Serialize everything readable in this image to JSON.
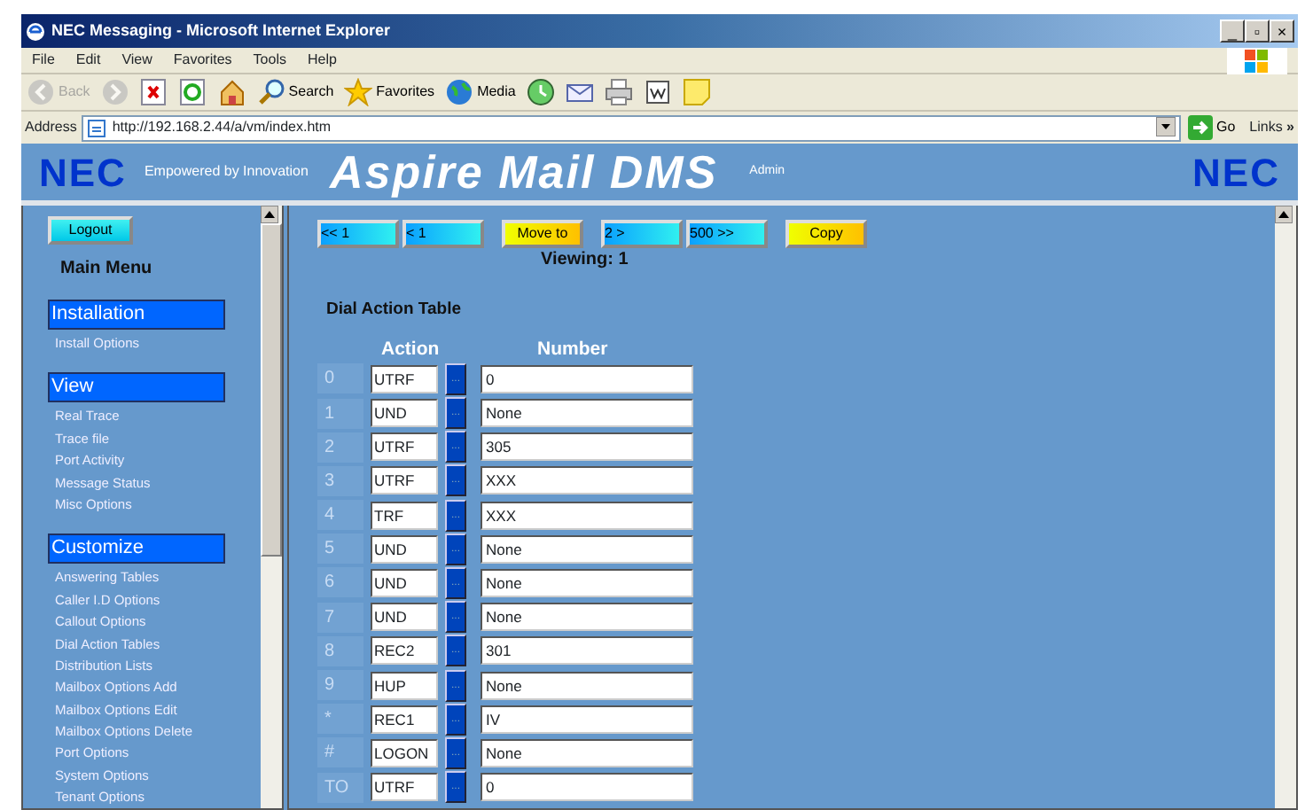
{
  "window": {
    "title": "NEC Messaging - Microsoft Internet Explorer",
    "controls": [
      "_",
      "▫",
      "×"
    ]
  },
  "menu_bar": [
    "File",
    "Edit",
    "View",
    "Favorites",
    "Tools",
    "Help"
  ],
  "toolbar": [
    {
      "kind": "back",
      "label": "Back",
      "disabled": true
    },
    {
      "kind": "forward",
      "disabled": true
    },
    {
      "kind": "stop",
      "disabled": false
    },
    {
      "kind": "refresh",
      "disabled": false
    },
    {
      "kind": "home",
      "disabled": false
    },
    {
      "kind": "search",
      "label": "Search",
      "disabled": false
    },
    {
      "kind": "favorites",
      "label": "Favorites",
      "disabled": false
    },
    {
      "kind": "media",
      "label": "Media",
      "disabled": false
    },
    {
      "kind": "history",
      "disabled": false
    },
    {
      "kind": "mail",
      "disabled": false
    },
    {
      "kind": "print",
      "disabled": false
    },
    {
      "kind": "edit",
      "disabled": false
    },
    {
      "kind": "note",
      "disabled": false
    }
  ],
  "address_bar": {
    "label": "Address",
    "value": "http://192.168.2.44/a/vm/index.htm",
    "go": "Go",
    "links": "Links",
    "links_chevron": "»"
  },
  "header": {
    "logo_left": "NEC",
    "tagline": "Empowered by Innovation",
    "product": "Aspire Mail DMS",
    "user": "Admin",
    "logo_right": "NEC"
  },
  "sidebar": {
    "logout": "Logout",
    "title": "Main Menu",
    "sections": [
      {
        "heading": "Installation",
        "items": [
          "Install Options"
        ]
      },
      {
        "heading": "View",
        "items": [
          "Real Trace",
          "Trace file",
          "Port Activity",
          "Message Status",
          "Misc Options"
        ]
      },
      {
        "heading": "Customize",
        "items": [
          "Answering Tables",
          "Caller I.D Options",
          "Callout Options",
          "Dial Action Tables",
          "Distribution Lists",
          "Mailbox Options Add",
          "Mailbox Options Edit",
          "Mailbox Options Delete",
          "Port Options",
          "System Options",
          "Tenant Options"
        ]
      }
    ]
  },
  "main": {
    "nav_buttons": [
      {
        "label": "<< 1",
        "kind": "nav"
      },
      {
        "label": "< 1",
        "kind": "nav"
      },
      {
        "label": "Move to",
        "kind": "action"
      },
      {
        "label": "2 >",
        "kind": "nav"
      },
      {
        "label": "500 >>",
        "kind": "nav"
      },
      {
        "label": "Copy",
        "kind": "action"
      }
    ],
    "viewing": "Viewing: 1",
    "table_title": "Dial Action Table",
    "columns": [
      "Action",
      "Number"
    ],
    "rows": [
      {
        "key": "0",
        "action": "UTRF",
        "more": "...",
        "number": "0"
      },
      {
        "key": "1",
        "action": "UND",
        "more": "...",
        "number": "None"
      },
      {
        "key": "2",
        "action": "UTRF",
        "more": "...",
        "number": "305"
      },
      {
        "key": "3",
        "action": "UTRF",
        "more": "...",
        "number": "XXX"
      },
      {
        "key": "4",
        "action": "TRF",
        "more": "...",
        "number": "XXX"
      },
      {
        "key": "5",
        "action": "UND",
        "more": "...",
        "number": "None"
      },
      {
        "key": "6",
        "action": "UND",
        "more": "...",
        "number": "None"
      },
      {
        "key": "7",
        "action": "UND",
        "more": "...",
        "number": "None"
      },
      {
        "key": "8",
        "action": "REC2",
        "more": "...",
        "number": "301"
      },
      {
        "key": "9",
        "action": "HUP",
        "more": "...",
        "number": "None"
      },
      {
        "key": "*",
        "action": "REC1",
        "more": "...",
        "number": "IV"
      },
      {
        "key": "#",
        "action": "LOGON",
        "more": "...",
        "number": "None"
      },
      {
        "key": "TO",
        "action": "UTRF",
        "more": "...",
        "number": "0"
      }
    ]
  }
}
